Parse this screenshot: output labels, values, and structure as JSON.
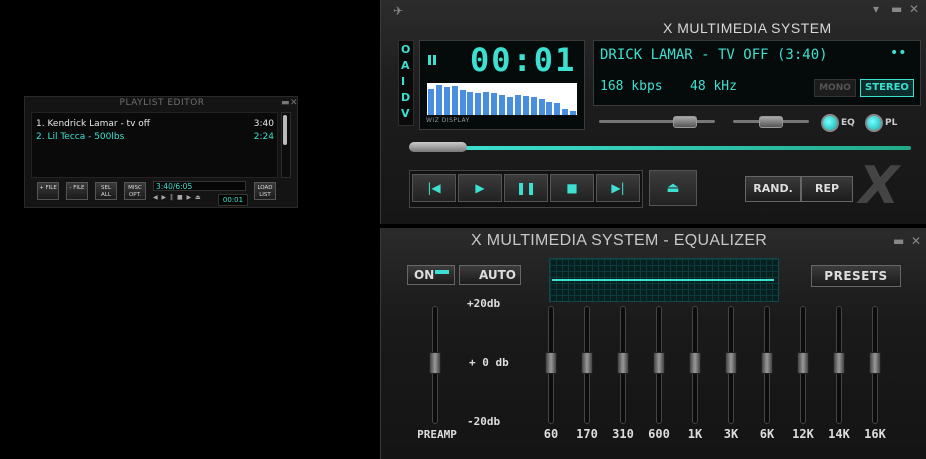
{
  "playlist": {
    "title": "PLAYLIST EDITOR",
    "items": [
      {
        "name": "1. Kendrick Lamar - tv off",
        "time": "3:40"
      },
      {
        "name": "2. Lil Tecca - 500lbs",
        "time": "2:24"
      }
    ],
    "buttons": {
      "add_file": "+ FILE",
      "rem_file": "- FILE",
      "sel_all": "SEL ALL",
      "misc_opt": "MISC OPT.",
      "load_list": "LOAD LIST"
    },
    "total_time": "3:40/6:05",
    "position": "00:01",
    "mini_controls": "◀ ▶ ‖ ■ ▶ ⏏"
  },
  "player": {
    "title": "X MULTIMEDIA SYSTEM",
    "oaidv": [
      "O",
      "A",
      "I",
      "D",
      "V"
    ],
    "time": "00:01",
    "vis_label": "WIZ DISPLAY",
    "song": "DRICK LAMAR - TV OFF (3:40)",
    "dots": "••",
    "bitrate": "168 kbps",
    "samplerate": "48 kHz",
    "mono": "MONO",
    "stereo": "STEREO",
    "eq_label": "EQ",
    "pl_label": "PL",
    "rand": "RAND.",
    "rep": "REP",
    "logo": "X",
    "visualizer": [
      0.82,
      0.95,
      0.88,
      0.9,
      0.78,
      0.72,
      0.68,
      0.72,
      0.7,
      0.62,
      0.55,
      0.62,
      0.58,
      0.55,
      0.5,
      0.42,
      0.38,
      0.2,
      0.12
    ],
    "accent": "#3de0d0"
  },
  "equalizer": {
    "title": "X MULTIMEDIA SYSTEM - EQUALIZER",
    "on": "ON",
    "auto": "AUTO",
    "presets": "PRESETS",
    "db_top": "+20db",
    "db_mid": "+ 0 db",
    "db_bot": "-20db",
    "preamp": "PREAMP",
    "bands": [
      "60",
      "170",
      "310",
      "600",
      "1K",
      "3K",
      "6K",
      "12K",
      "14K",
      "16K"
    ]
  }
}
